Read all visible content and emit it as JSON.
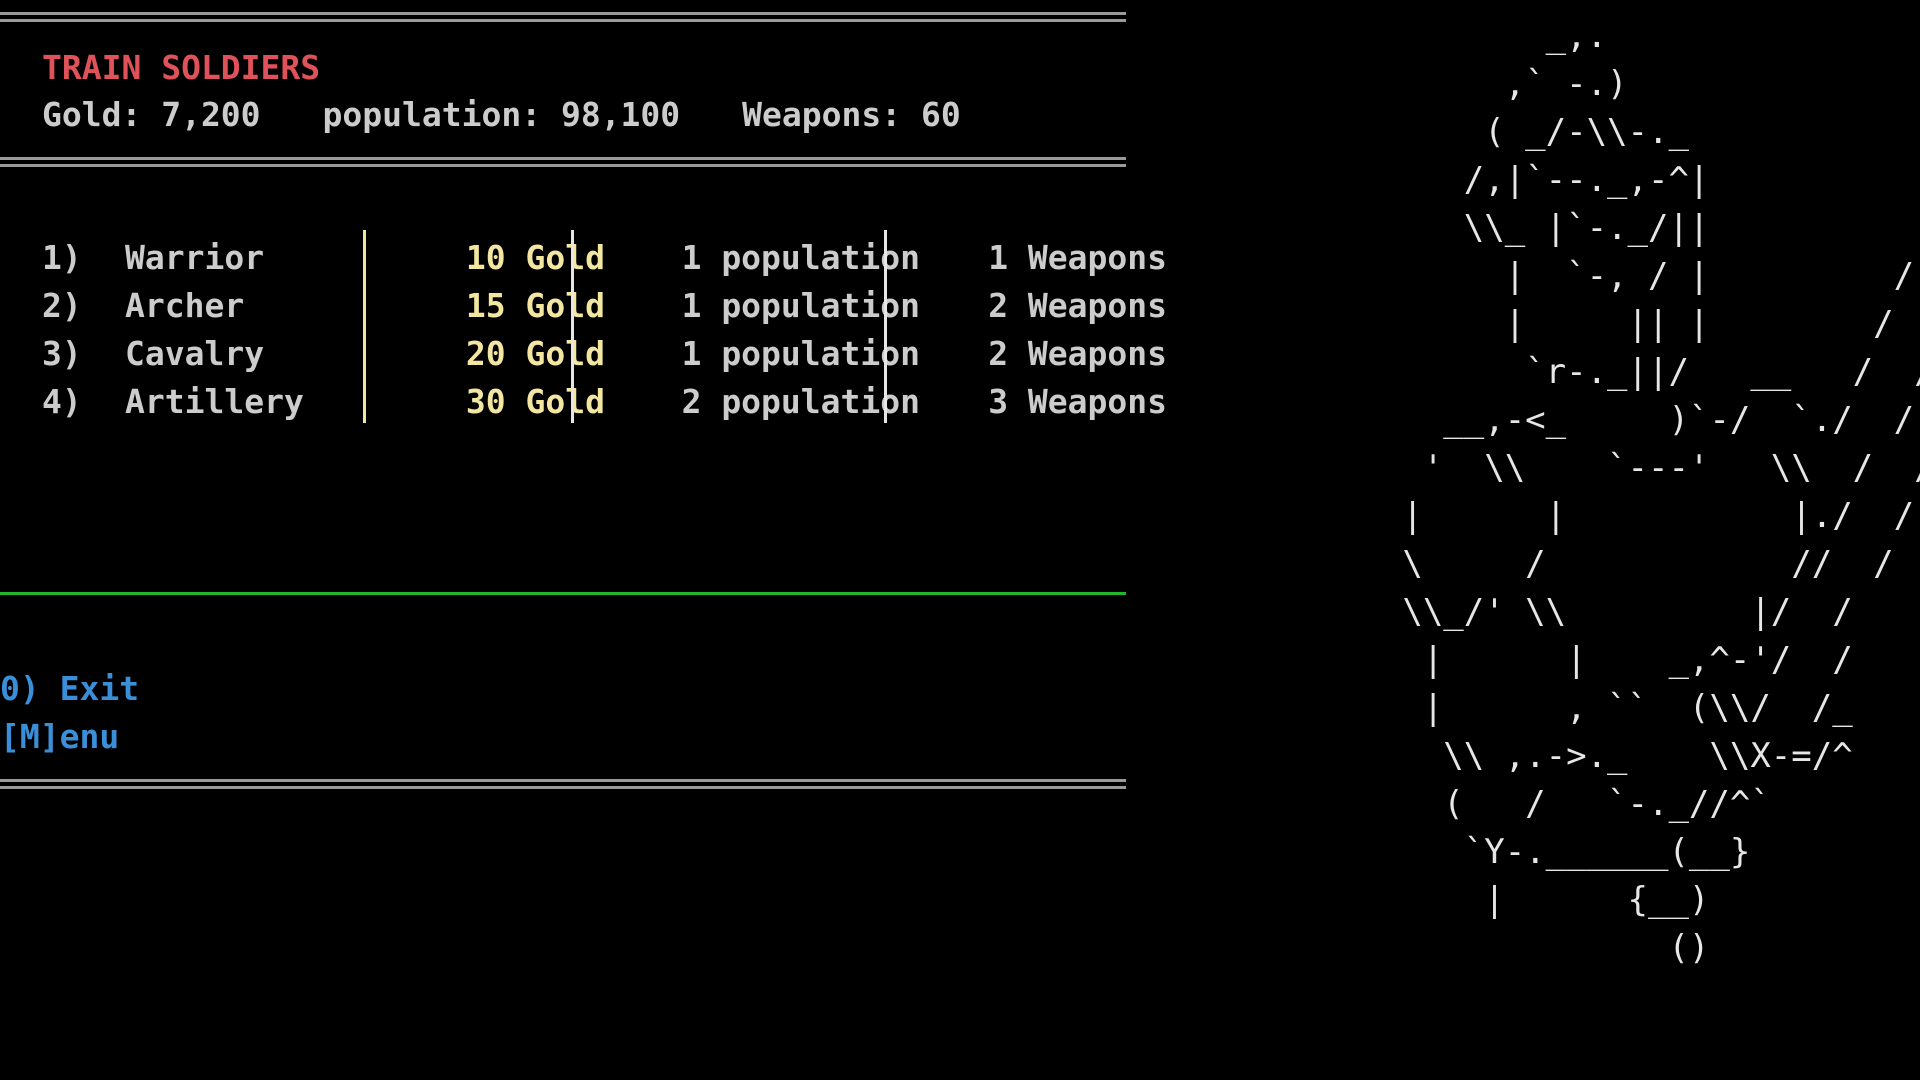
{
  "screen": {
    "title": "TRAIN SOLDIERS",
    "resources": {
      "gold": "Gold: 7,200",
      "population": "population: 98,100",
      "weapons": "Weapons: 60"
    },
    "units": [
      {
        "number": "1)",
        "name": "Warrior",
        "gold": "10 Gold",
        "population": "1 population",
        "weapons": "1 Weapons"
      },
      {
        "number": "2)",
        "name": "Archer",
        "gold": "15 Gold",
        "population": "1 population",
        "weapons": "2 Weapons"
      },
      {
        "number": "3)",
        "name": "Cavalry",
        "gold": "20 Gold",
        "population": "1 population",
        "weapons": "2 Weapons"
      },
      {
        "number": "4)",
        "name": "Artillery",
        "gold": "30 Gold",
        "population": "2 population",
        "weapons": "3 Weapons"
      }
    ],
    "menu": {
      "exit": "0) Exit",
      "main_menu": "[M]enu"
    },
    "ascii_art": "            _,.\n          ,` -.)\n         ( _/-\\\\-._\n        /,|`--._,-^|            ,\n        \\\\_ |`-._/||          ,'|\n          |  `-, / |         /  /\n          |     || |        /  /\n           `r-._||/   __   /  /\n       __,-<_     )`-/  `./  /\n      '  \\\\    `---'   \\\\  /  /\n     |      |           |./  /\n     \\     /            //  /\n     \\\\_/' \\\\         |/  /\n      |      |    _,^-'/  /\n      |      , ``  (\\\\/  /_\n       \\\\ ,.->._    \\\\X-=/^\n       (   /   `-._//^`\n        `Y-.______(__}\n         |      {__)\n                  ()",
    "colors": {
      "background": "#000000",
      "title": "#e0525a",
      "text": "#cccccc",
      "gold": "#f2e6a0",
      "menu": "#3b8fd9",
      "divider": "#22b82b",
      "rule": "#9a9a9a"
    }
  }
}
